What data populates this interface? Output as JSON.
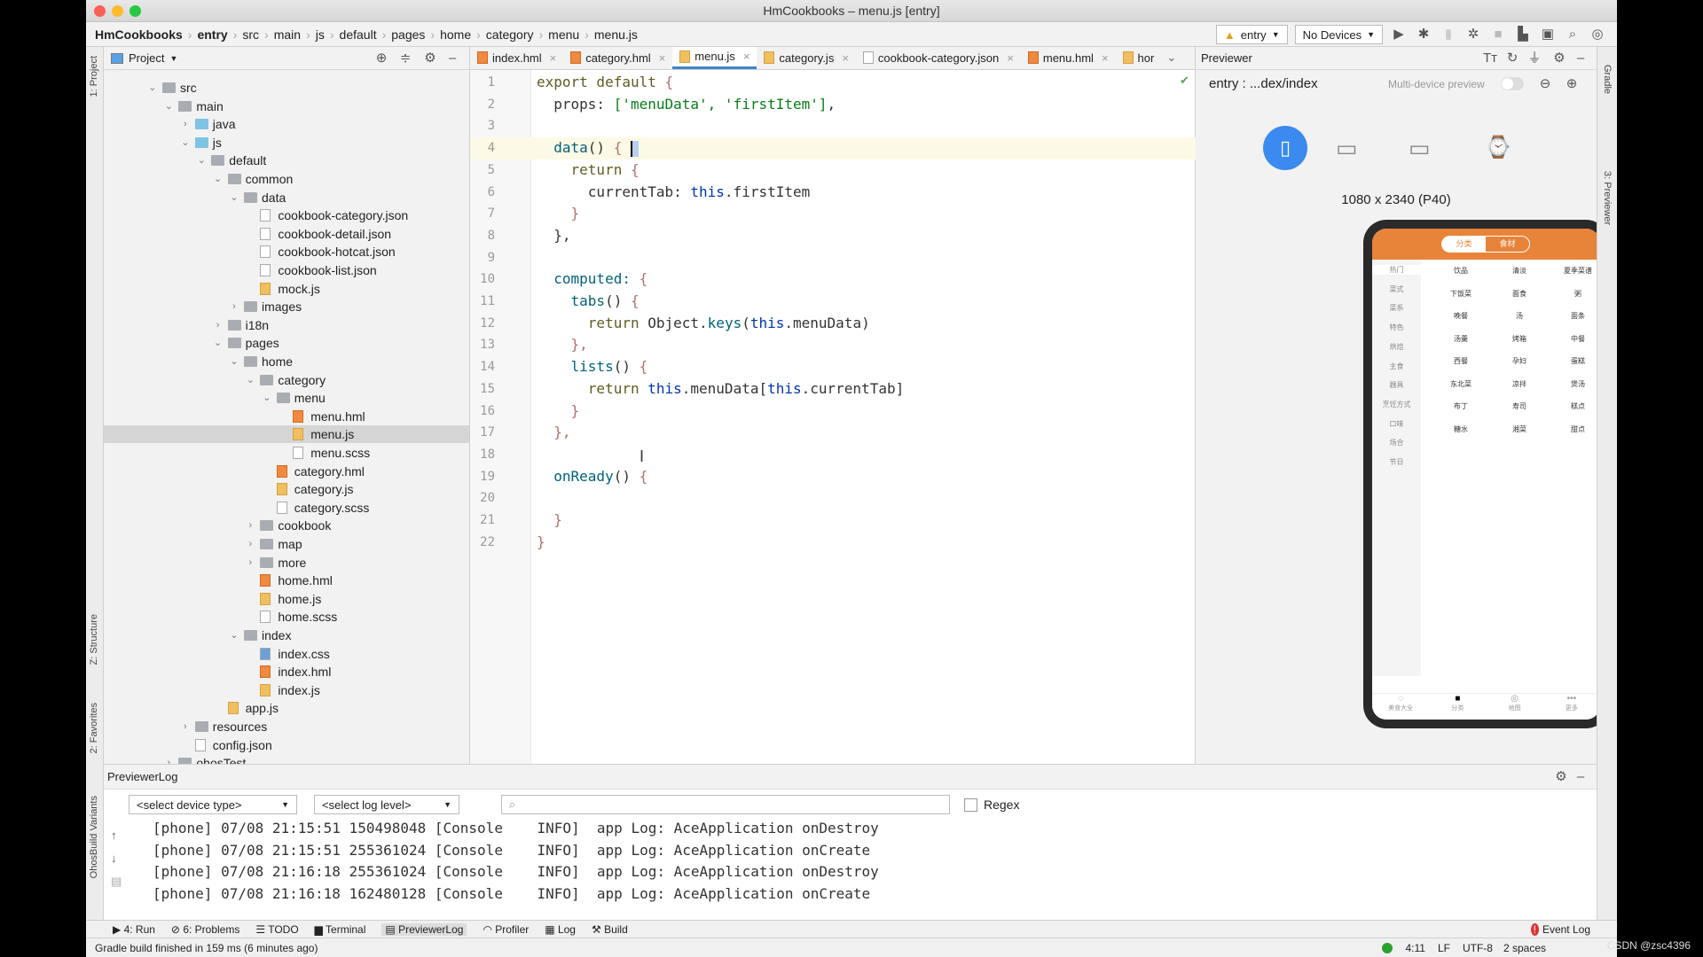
{
  "window": {
    "title": "HmCookbooks – menu.js [entry]"
  },
  "breadcrumb": [
    "HmCookbooks",
    "entry",
    "src",
    "main",
    "js",
    "default",
    "pages",
    "home",
    "category",
    "menu",
    "menu.js"
  ],
  "toolbar": {
    "module": "entry",
    "device": "No Devices"
  },
  "left_stripe": {
    "project": "1: Project",
    "structure": "Z: Structure",
    "favorites": "2: Favorites",
    "variants": "OhosBuild Variants"
  },
  "right_stripe": {
    "gradle": "Gradle",
    "previewer": "3: Previewer"
  },
  "project_panel": {
    "title": "Project"
  },
  "tree": [
    {
      "d": 0,
      "t": "folder",
      "o": true,
      "n": "src"
    },
    {
      "d": 1,
      "t": "folder",
      "o": true,
      "n": "main"
    },
    {
      "d": 2,
      "t": "folder-blue",
      "o": false,
      "n": "java"
    },
    {
      "d": 2,
      "t": "folder-blue",
      "o": true,
      "n": "js"
    },
    {
      "d": 3,
      "t": "folder",
      "o": true,
      "n": "default"
    },
    {
      "d": 4,
      "t": "folder",
      "o": true,
      "n": "common"
    },
    {
      "d": 5,
      "t": "folder",
      "o": true,
      "n": "data"
    },
    {
      "d": 6,
      "t": "json",
      "n": "cookbook-category.json"
    },
    {
      "d": 6,
      "t": "json",
      "n": "cookbook-detail.json"
    },
    {
      "d": 6,
      "t": "json",
      "n": "cookbook-hotcat.json"
    },
    {
      "d": 6,
      "t": "json",
      "n": "cookbook-list.json"
    },
    {
      "d": 6,
      "t": "js",
      "n": "mock.js"
    },
    {
      "d": 5,
      "t": "folder",
      "o": false,
      "n": "images"
    },
    {
      "d": 4,
      "t": "folder",
      "o": false,
      "n": "i18n"
    },
    {
      "d": 4,
      "t": "folder",
      "o": true,
      "n": "pages"
    },
    {
      "d": 5,
      "t": "folder",
      "o": true,
      "n": "home"
    },
    {
      "d": 6,
      "t": "folder",
      "o": true,
      "n": "category"
    },
    {
      "d": 7,
      "t": "folder",
      "o": true,
      "n": "menu"
    },
    {
      "d": 8,
      "t": "hml",
      "n": "menu.hml"
    },
    {
      "d": 8,
      "t": "js",
      "n": "menu.js",
      "selected": true
    },
    {
      "d": 8,
      "t": "scss",
      "n": "menu.scss"
    },
    {
      "d": 7,
      "t": "hml",
      "n": "category.hml"
    },
    {
      "d": 7,
      "t": "js",
      "n": "category.js"
    },
    {
      "d": 7,
      "t": "scss",
      "n": "category.scss"
    },
    {
      "d": 6,
      "t": "folder",
      "o": false,
      "n": "cookbook"
    },
    {
      "d": 6,
      "t": "folder",
      "o": false,
      "n": "map"
    },
    {
      "d": 6,
      "t": "folder",
      "o": false,
      "n": "more"
    },
    {
      "d": 6,
      "t": "hml",
      "n": "home.hml"
    },
    {
      "d": 6,
      "t": "js",
      "n": "home.js"
    },
    {
      "d": 6,
      "t": "scss",
      "n": "home.scss"
    },
    {
      "d": 5,
      "t": "folder",
      "o": true,
      "n": "index"
    },
    {
      "d": 6,
      "t": "css",
      "n": "index.css"
    },
    {
      "d": 6,
      "t": "hml",
      "n": "index.hml"
    },
    {
      "d": 6,
      "t": "js",
      "n": "index.js"
    },
    {
      "d": 4,
      "t": "js",
      "n": "app.js"
    },
    {
      "d": 2,
      "t": "folder",
      "o": false,
      "n": "resources"
    },
    {
      "d": 2,
      "t": "json",
      "n": "config.json"
    },
    {
      "d": 1,
      "t": "folder",
      "o": false,
      "n": "ohosTest"
    }
  ],
  "editor_tabs": [
    {
      "label": "index.hml",
      "type": "hml"
    },
    {
      "label": "category.hml",
      "type": "hml"
    },
    {
      "label": "menu.js",
      "type": "js",
      "active": true
    },
    {
      "label": "category.js",
      "type": "js"
    },
    {
      "label": "cookbook-category.json",
      "type": "json"
    },
    {
      "label": "menu.hml",
      "type": "hml"
    },
    {
      "label": "hor",
      "type": "js"
    }
  ],
  "code": [
    [
      [
        "export default ",
        "kw"
      ],
      [
        "{",
        "br"
      ]
    ],
    [
      [
        "  props: ",
        "pl"
      ],
      [
        "['menuData', 'firstItem']",
        "str"
      ],
      [
        ",",
        "pl"
      ]
    ],
    [],
    [
      [
        "  data",
        "fn"
      ],
      [
        "() ",
        "pl"
      ],
      [
        "{",
        "br"
      ]
    ],
    [
      [
        "    return ",
        "kw"
      ],
      [
        "{",
        "br"
      ]
    ],
    [
      [
        "      currentTab: ",
        "pl"
      ],
      [
        "this",
        "th"
      ],
      [
        ".firstItem",
        "pl"
      ]
    ],
    [
      [
        "    }",
        "br"
      ]
    ],
    [
      [
        "  },",
        "pl"
      ]
    ],
    [],
    [
      [
        "  computed: ",
        "fn"
      ],
      [
        "{",
        "br"
      ]
    ],
    [
      [
        "    tabs",
        "fn"
      ],
      [
        "() ",
        "pl"
      ],
      [
        "{",
        "br"
      ]
    ],
    [
      [
        "      return ",
        "kw"
      ],
      [
        "Object.",
        "pl"
      ],
      [
        "keys",
        "fn"
      ],
      [
        "(",
        "pl"
      ],
      [
        "this",
        "th"
      ],
      [
        ".menuData)",
        "pl"
      ]
    ],
    [
      [
        "    },",
        "br"
      ]
    ],
    [
      [
        "    lists",
        "fn"
      ],
      [
        "() ",
        "pl"
      ],
      [
        "{",
        "br"
      ]
    ],
    [
      [
        "      return ",
        "kw"
      ],
      [
        "this",
        "th"
      ],
      [
        ".menuData[",
        "pl"
      ],
      [
        "this",
        "th"
      ],
      [
        ".currentTab]",
        "pl"
      ]
    ],
    [
      [
        "    }",
        "br"
      ]
    ],
    [
      [
        "  },",
        "br"
      ]
    ],
    [],
    [
      [
        "  onReady",
        "fn"
      ],
      [
        "() ",
        "pl"
      ],
      [
        "{",
        "br"
      ]
    ],
    [],
    [
      [
        "  }",
        "br"
      ]
    ],
    [
      [
        "}",
        "br"
      ]
    ]
  ],
  "previewer": {
    "title": "Previewer",
    "path": "entry : ...dex/index",
    "multi_device": "Multi-device preview",
    "multi_device_on": false,
    "resolution": "1080 x 2340 (P40)"
  },
  "phone": {
    "top_tabs": [
      "分类",
      "食材"
    ],
    "categories": [
      "热门",
      "菜式",
      "菜系",
      "特色",
      "烘焙",
      "主食",
      "器具",
      "烹饪方式",
      "口味",
      "场合",
      "节日"
    ],
    "items": [
      "饮品",
      "清淡",
      "夏季菜谱",
      "下饭菜",
      "面食",
      "粥",
      "晚餐",
      "汤",
      "面条",
      "汤羹",
      "烤箱",
      "中餐",
      "西餐",
      "孕妇",
      "蛋糕",
      "东北菜",
      "凉拌",
      "煲汤",
      "布丁",
      "寿司",
      "糕点",
      "糖水",
      "湘菜",
      "甜点"
    ],
    "nav": [
      "美食大全",
      "分类",
      "地图",
      "更多"
    ],
    "accent": "#e8833a"
  },
  "log": {
    "title": "PreviewerLog",
    "device_select": "<select device type>",
    "level_select": "<select log level>",
    "search_placeholder": "",
    "regex": "Regex",
    "lines": [
      "[phone] 07/08 21:15:51 150498048 [Console    INFO]  app Log: AceApplication onDestroy",
      "[phone] 07/08 21:15:51 255361024 [Console    INFO]  app Log: AceApplication onCreate",
      "[phone] 07/08 21:16:18 255361024 [Console    INFO]  app Log: AceApplication onDestroy",
      "[phone] 07/08 21:16:18 162480128 [Console    INFO]  app Log: AceApplication onCreate"
    ]
  },
  "bottom_tabs": [
    "4: Run",
    "6: Problems",
    "TODO",
    "Terminal",
    "PreviewerLog",
    "Profiler",
    "Log",
    "Build"
  ],
  "event_log": "Event Log",
  "status": {
    "message": "Gradle build finished in 159 ms (6 minutes ago)",
    "position": "4:11",
    "line_sep": "LF",
    "encoding": "UTF-8",
    "indent": "2 spaces"
  },
  "watermark": "CSDN @zsc4396"
}
